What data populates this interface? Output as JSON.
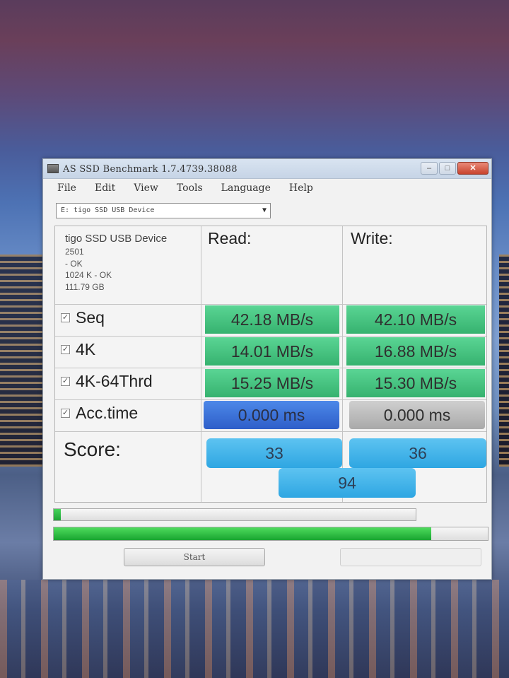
{
  "window": {
    "title": "AS SSD Benchmark 1.7.4739.38088",
    "menu": [
      "File",
      "Edit",
      "View",
      "Tools",
      "Language",
      "Help"
    ],
    "drive_select": "E: tigo SSD USB Device"
  },
  "device": {
    "name": "tigo SSD USB Device",
    "firmware": "2501",
    "driver_status": " - OK",
    "alignment": "1024 K - OK",
    "capacity": "111.79 GB"
  },
  "columns": {
    "read": "Read:",
    "write": "Write:"
  },
  "rows": [
    {
      "label": "Seq",
      "checked": true,
      "read": "42.18 MB/s",
      "write": "42.10 MB/s"
    },
    {
      "label": "4K",
      "checked": true,
      "read": "14.01 MB/s",
      "write": "16.88 MB/s"
    },
    {
      "label": "4K-64Thrd",
      "checked": true,
      "read": "15.25 MB/s",
      "write": "15.30 MB/s"
    },
    {
      "label": "Acc.time",
      "checked": true,
      "read": "0.000 ms",
      "write": "0.000 ms"
    }
  ],
  "score": {
    "label": "Score:",
    "read": "33",
    "write": "36",
    "total": "94"
  },
  "progress": {
    "current_fraction": 0.02,
    "overall_fraction": 0.87
  },
  "buttons": {
    "start": "Start"
  },
  "colors": {
    "cell_green": "#3fc07a",
    "acc_read_blue": "#3a70d8",
    "acc_write_gray": "#bdbdbd",
    "score_blue": "#3fb2e8",
    "progress_green": "#2bbd42"
  }
}
